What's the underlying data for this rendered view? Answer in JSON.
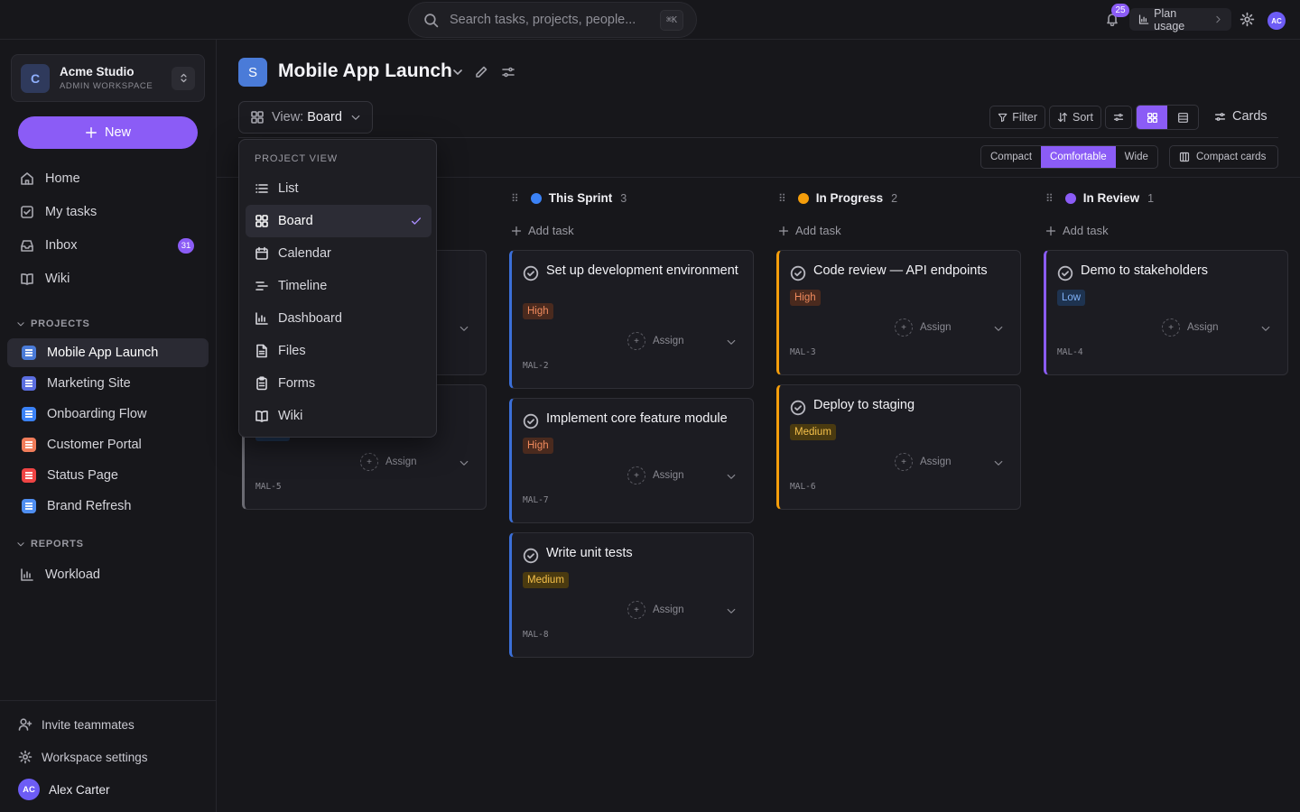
{
  "topbar": {
    "search_placeholder": "Search tasks, projects, people...",
    "search_shortcut": "⌘K",
    "notifications_count": "25",
    "plan_label": "Plan usage",
    "avatar_initials": "AC"
  },
  "workspace": {
    "logo": "C",
    "name": "Acme Studio",
    "subtitle": "ADMIN WORKSPACE"
  },
  "sidebar": {
    "new_label": "New",
    "nav": [
      {
        "label": "Home",
        "icon": "home-icon"
      },
      {
        "label": "My tasks",
        "icon": "checkbox-icon"
      },
      {
        "label": "Inbox",
        "icon": "inbox-icon",
        "badge": "31"
      },
      {
        "label": "Wiki",
        "icon": "book-icon"
      }
    ],
    "projects_heading": "PROJECTS",
    "projects": [
      {
        "label": "Mobile App Launch",
        "color": "#4a7bd8"
      },
      {
        "label": "Marketing Site",
        "color": "#5b6ee0"
      },
      {
        "label": "Onboarding Flow",
        "color": "#3b82f6"
      },
      {
        "label": "Customer Portal",
        "color": "#f07c5a"
      },
      {
        "label": "Status Page",
        "color": "#ef4444"
      },
      {
        "label": "Brand Refresh",
        "color": "#4f8ef0"
      }
    ],
    "reports_heading": "REPORTS",
    "reports": [
      {
        "label": "Workload"
      }
    ],
    "footer": {
      "invite": "Invite teammates",
      "settings": "Workspace settings",
      "user_initials": "AC",
      "user_name": "Alex Carter"
    }
  },
  "header": {
    "project_logo": "S",
    "project_title": "Mobile App Launch",
    "view_prefix": "View:",
    "view_value": "Board",
    "filter": "Filter",
    "sort": "Sort",
    "cards": "Cards",
    "density": [
      "Compact",
      "Comfortable",
      "Wide"
    ],
    "density_selected": "Comfortable",
    "compact_cards": "Compact cards"
  },
  "view_menu": {
    "heading": "PROJECT VIEW",
    "items": [
      {
        "label": "List",
        "icon": "list-icon"
      },
      {
        "label": "Board",
        "icon": "board-icon",
        "selected": true
      },
      {
        "label": "Calendar",
        "icon": "calendar-icon"
      },
      {
        "label": "Timeline",
        "icon": "timeline-icon"
      },
      {
        "label": "Dashboard",
        "icon": "dashboard-icon"
      },
      {
        "label": "Files",
        "icon": "file-icon"
      },
      {
        "label": "Forms",
        "icon": "clipboard-icon"
      },
      {
        "label": "Wiki",
        "icon": "book-icon"
      }
    ]
  },
  "board": {
    "add_task": "Add task",
    "assign": "Assign",
    "columns": [
      {
        "name": "This Sprint",
        "count": "3",
        "color": "#3b82f6"
      },
      {
        "name": "In Progress",
        "count": "2",
        "color": "#f59e0b"
      },
      {
        "name": "In Review",
        "count": "1",
        "color": "#8b5cf6"
      }
    ],
    "cards": [
      {
        "id": "MAL-5"
      },
      {
        "title": "Set up development environment",
        "priority": "High",
        "id": "MAL-2"
      },
      {
        "title": "Implement core feature module",
        "priority": "High",
        "id": "MAL-7"
      },
      {
        "title": "Write unit tests",
        "priority": "Medium",
        "id": "MAL-8"
      },
      {
        "title": "Code review — API endpoints",
        "priority": "High",
        "id": "MAL-3"
      },
      {
        "title": "Deploy to staging",
        "priority": "Medium",
        "id": "MAL-6"
      },
      {
        "title": "Demo to stakeholders",
        "priority": "Low",
        "id": "MAL-4"
      }
    ]
  }
}
